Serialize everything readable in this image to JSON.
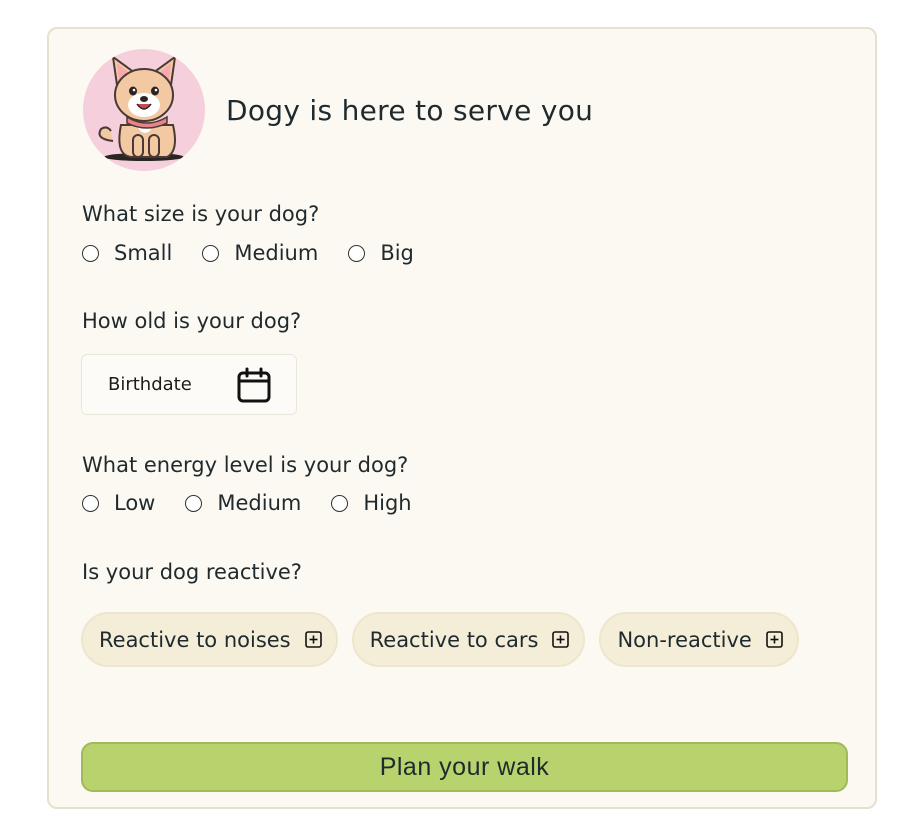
{
  "header": {
    "title": "Dogy is here to serve you",
    "avatar_icon": "dog-mascot-icon"
  },
  "size": {
    "question": "What size is your dog?",
    "options": [
      "Small",
      "Medium",
      "Big"
    ]
  },
  "age": {
    "question": "How old is your dog?",
    "input_placeholder": "Birthdate",
    "icon": "calendar-icon"
  },
  "energy": {
    "question": "What energy level is your dog?",
    "options": [
      "Low",
      "Medium",
      "High"
    ]
  },
  "reactive": {
    "question": "Is your dog reactive?",
    "options": [
      "Reactive to noises",
      "Reactive to cars",
      "Non-reactive"
    ],
    "icon": "plus-square-icon"
  },
  "submit": {
    "label": "Plan your walk"
  },
  "colors": {
    "card_bg": "#fcf9f2",
    "accent_green": "#b8d26d",
    "chip_bg": "#f4eed9",
    "avatar_bg": "#f6cfdc"
  }
}
